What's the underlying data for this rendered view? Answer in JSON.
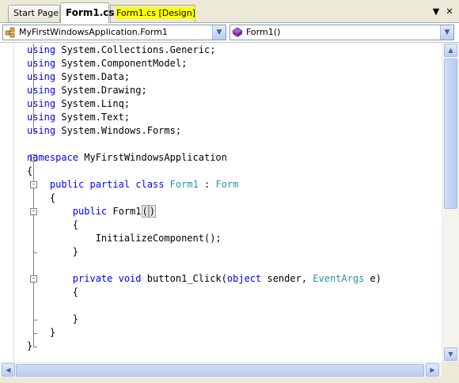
{
  "tabs": [
    {
      "label": "Start Page"
    },
    {
      "label": "Form1.cs"
    },
    {
      "label": "Form1.cs [Design]"
    }
  ],
  "tab_controls": {
    "dropdown_glyph": "▼",
    "close_glyph": "✕"
  },
  "nav": {
    "type_combo": {
      "value": "MyFirstWindowsApplication.Form1",
      "icon": "class-icon"
    },
    "member_combo": {
      "value": "Form1()",
      "icon": "method-icon"
    }
  },
  "code": {
    "lines": [
      [
        {
          "k": "kw",
          "t": "using"
        },
        {
          "k": "",
          "t": " System.Collections.Generic;"
        }
      ],
      [
        {
          "k": "kw",
          "t": "using"
        },
        {
          "k": "",
          "t": " System.ComponentModel;"
        }
      ],
      [
        {
          "k": "kw",
          "t": "using"
        },
        {
          "k": "",
          "t": " System.Data;"
        }
      ],
      [
        {
          "k": "kw",
          "t": "using"
        },
        {
          "k": "",
          "t": " System.Drawing;"
        }
      ],
      [
        {
          "k": "kw",
          "t": "using"
        },
        {
          "k": "",
          "t": " System.Linq;"
        }
      ],
      [
        {
          "k": "kw",
          "t": "using"
        },
        {
          "k": "",
          "t": " System.Text;"
        }
      ],
      [
        {
          "k": "kw",
          "t": "using"
        },
        {
          "k": "",
          "t": " System.Windows.Forms;"
        }
      ],
      [],
      [
        {
          "k": "kw",
          "t": "namespace"
        },
        {
          "k": "",
          "t": " MyFirstWindowsApplication"
        }
      ],
      [
        {
          "k": "",
          "t": "{"
        }
      ],
      [
        {
          "k": "",
          "t": "    "
        },
        {
          "k": "kw",
          "t": "public"
        },
        {
          "k": "",
          "t": " "
        },
        {
          "k": "kw",
          "t": "partial"
        },
        {
          "k": "",
          "t": " "
        },
        {
          "k": "kw",
          "t": "class"
        },
        {
          "k": "",
          "t": " "
        },
        {
          "k": "ty",
          "t": "Form1"
        },
        {
          "k": "",
          "t": " : "
        },
        {
          "k": "ty",
          "t": "Form"
        }
      ],
      [
        {
          "k": "",
          "t": "    {"
        }
      ],
      [
        {
          "k": "",
          "t": "        "
        },
        {
          "k": "kw",
          "t": "public"
        },
        {
          "k": "",
          "t": " Form1"
        },
        {
          "k": "hl",
          "t": "("
        },
        {
          "k": "hl",
          "t": ")"
        }
      ],
      [
        {
          "k": "",
          "t": "        {"
        }
      ],
      [
        {
          "k": "",
          "t": "            InitializeComponent();"
        }
      ],
      [
        {
          "k": "",
          "t": "        }"
        }
      ],
      [],
      [
        {
          "k": "",
          "t": "        "
        },
        {
          "k": "kw",
          "t": "private"
        },
        {
          "k": "",
          "t": " "
        },
        {
          "k": "kw",
          "t": "void"
        },
        {
          "k": "",
          "t": " button1_Click("
        },
        {
          "k": "kw",
          "t": "object"
        },
        {
          "k": "",
          "t": " sender, "
        },
        {
          "k": "ty",
          "t": "EventArgs"
        },
        {
          "k": "",
          "t": " e)"
        }
      ],
      [
        {
          "k": "",
          "t": "        {"
        }
      ],
      [],
      [
        {
          "k": "",
          "t": "        }"
        }
      ],
      [
        {
          "k": "",
          "t": "    }"
        }
      ],
      [
        {
          "k": "",
          "t": "}"
        }
      ]
    ]
  },
  "scroll": {
    "up_glyph": "▲",
    "down_glyph": "▼",
    "left_glyph": "◀",
    "right_glyph": "▶"
  }
}
